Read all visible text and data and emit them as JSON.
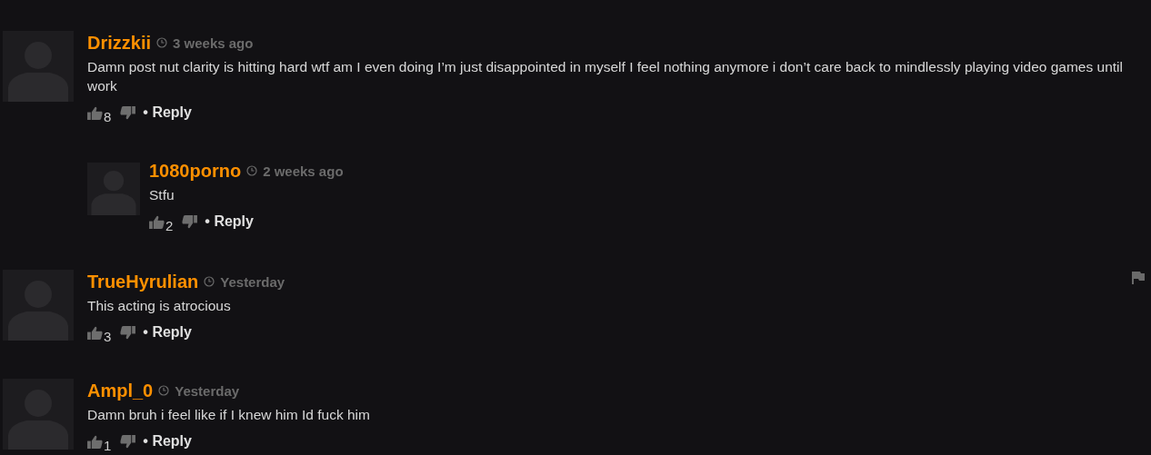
{
  "comments": [
    {
      "username": "Drizzkii",
      "time": "3 weeks ago",
      "body": "Damn post nut clarity is hitting hard wtf am I even doing I’m just disappointed in myself I feel nothing anymore i don’t care back to mindlessly playing video games until work",
      "likes": "8",
      "reply": "• Reply",
      "flag_shown": false,
      "replies": [
        {
          "username": "1080porno",
          "time": "2 weeks ago",
          "body": "Stfu",
          "likes": "2",
          "reply": "• Reply",
          "flag_shown": false
        }
      ]
    },
    {
      "username": "TrueHyrulian",
      "time": "Yesterday",
      "body": "This acting is atrocious",
      "likes": "3",
      "reply": "• Reply",
      "flag_shown": true
    },
    {
      "username": "Ampl_0",
      "time": "Yesterday",
      "body": "Damn bruh i feel like if I knew him Id fuck him",
      "likes": "1",
      "reply": "• Reply",
      "flag_shown": false
    }
  ]
}
